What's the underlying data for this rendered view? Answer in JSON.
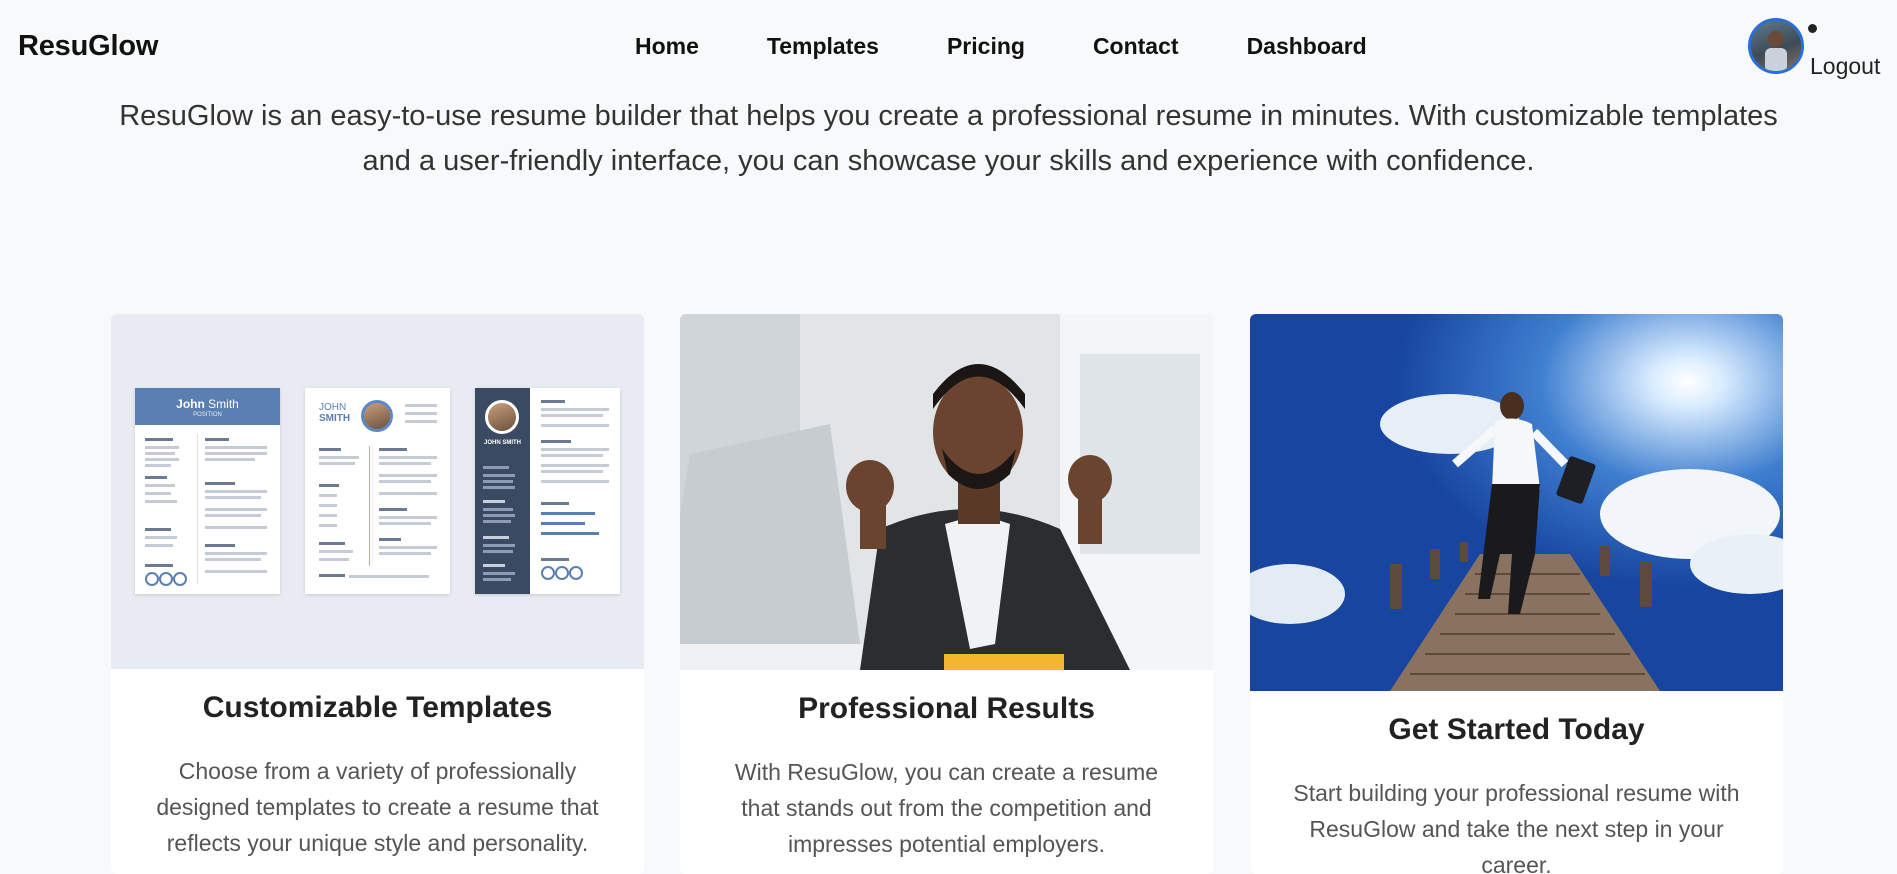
{
  "nav": {
    "brand": "ResuGlow",
    "links": [
      "Home",
      "Templates",
      "Pricing",
      "Contact",
      "Dashboard"
    ],
    "logout_label": "Logout"
  },
  "intro": {
    "text": "ResuGlow is an easy-to-use resume builder that helps you create a professional resume in minutes. With customizable templates and a user-friendly interface, you can showcase your skills and experience with confidence."
  },
  "cards": [
    {
      "title": "Customizable Templates",
      "text": "Choose from a variety of professionally designed templates to create a resume that reflects your unique style and personality."
    },
    {
      "title": "Professional Results",
      "text": "With ResuGlow, you can create a resume that stands out from the competition and impresses potential employers."
    },
    {
      "title": "Get Started Today",
      "text": "Start building your professional resume with ResuGlow and take the next step in your career."
    }
  ],
  "resume_mockups": {
    "first_name": "John",
    "last_name": "Smith",
    "position": "POSITION"
  },
  "colors": {
    "background": "#f8f9fb",
    "accent": "#2b6fd6",
    "resume_header": "#5b7fb0",
    "resume_sidebar": "#3b4a63"
  }
}
